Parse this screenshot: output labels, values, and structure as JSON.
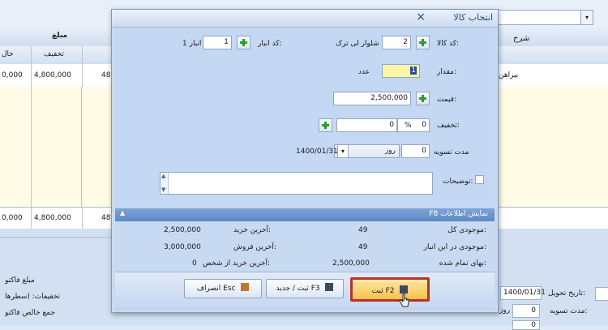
{
  "background": {
    "header_amount": "مبلغ",
    "header_description_partial": "شرح",
    "col_discount": "تخفیف",
    "col_net_partial": "خال",
    "row1": {
      "amount_partial": "0,000",
      "discount": "4,800,000",
      "next_partial": "48",
      "description_partial": "بیراهن"
    },
    "total": {
      "amount_partial": "0,000",
      "discount": "4,800,000",
      "next_partial": "48"
    },
    "bottom_left_labels": [
      "مبلغ فاکتو",
      "تخفیفات: (سطرها",
      "جمع خالص فاکتو"
    ],
    "delivery_date_label": "تاریخ تحویل:",
    "delivery_date_value": "1400/01/31",
    "settle_label": "مدت تسویه:",
    "settle_days": "0",
    "settle_unit": "روز",
    "extra_value": "0"
  },
  "dialog": {
    "title": "انتخاب کالا",
    "close_glyph": "×",
    "product_code_label": "کد کالا:",
    "product_code_value": "2",
    "product_name": "شلوار لی ترک",
    "warehouse_label": "کد انبار:",
    "warehouse_code_value": "1",
    "warehouse_name": "انبار 1",
    "quantity_label": "مقدار:",
    "quantity_value": "1",
    "quantity_unit": "عدد",
    "price_label": "قیمت:",
    "price_value": "2,500,000",
    "discount_label": "تخفیف:",
    "discount_percent_value": "0",
    "discount_percent_sign": "%",
    "discount_amount_value": "0",
    "settlement_label": "مدت تسویه",
    "settlement_days": "0",
    "settlement_unit": "روز",
    "settlement_date": "1400/01/31",
    "notes_label": "توضیحات:",
    "section_title": "F8 نمایش اطلاعات",
    "info": {
      "total_stock_label": "موجودی کل:",
      "total_stock_value": "49",
      "warehouse_stock_label": "موجودی در این انبار:",
      "warehouse_stock_value": "49",
      "cost_price_label": "بهای تمام شده:",
      "cost_price_value": "2,500,000",
      "last_purchase_label": "آخرین خرید:",
      "last_purchase_value": "2,500,000",
      "last_sale_label": "آخرین فروش:",
      "last_sale_value": "3,000,000",
      "last_purchase_person_label": "آخرین خرید از شخص:",
      "last_purchase_person_value": "0"
    },
    "buttons": {
      "save": "ثبت F2",
      "save_new": "ثبت / جدید F3",
      "cancel": "انصراف Esc"
    }
  }
}
